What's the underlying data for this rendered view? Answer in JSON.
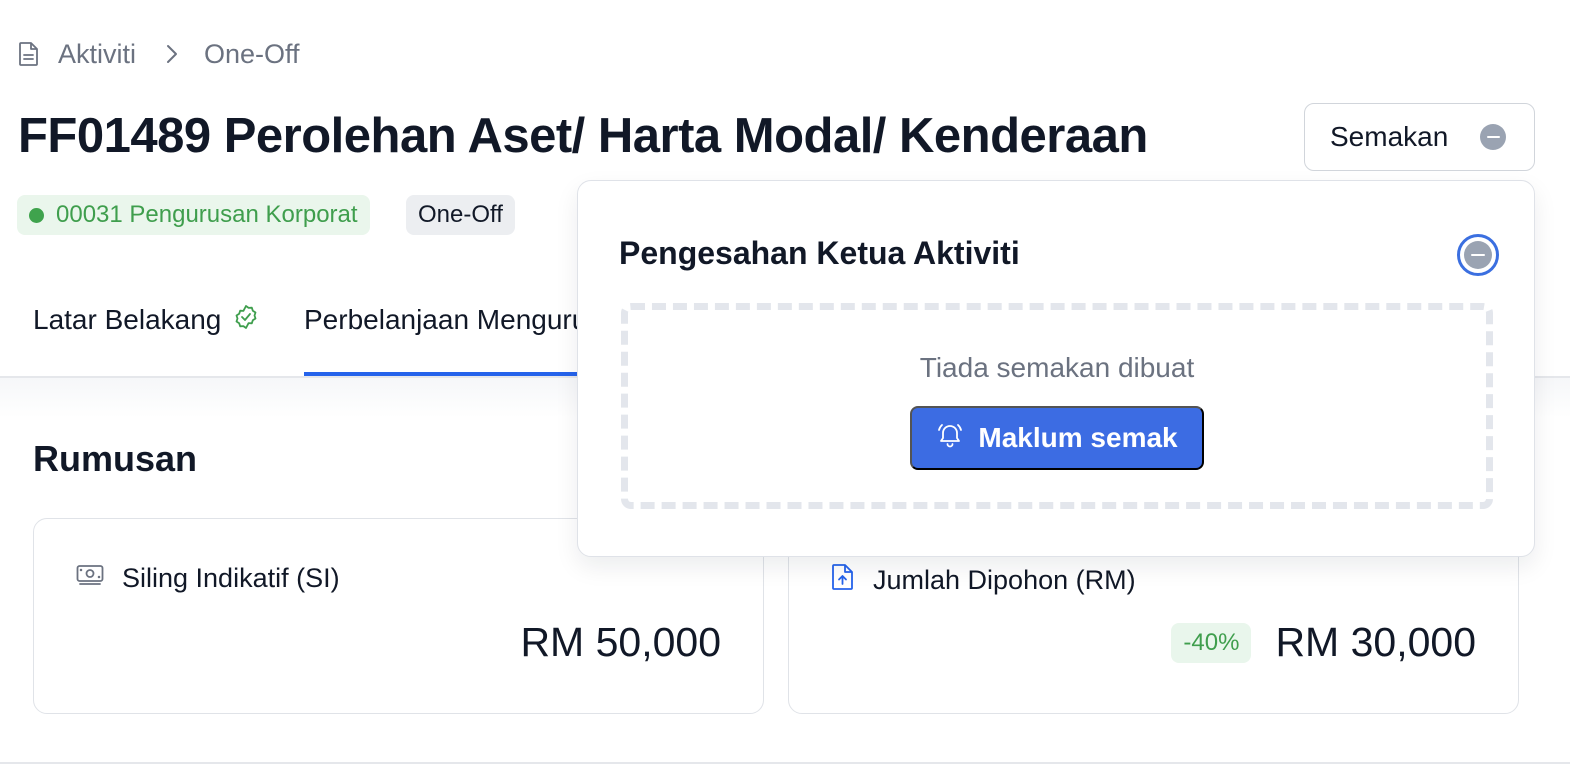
{
  "breadcrumb": {
    "icon": "document-icon",
    "root": "Aktiviti",
    "current": "One-Off"
  },
  "title": "FF01489 Perolehan Aset/ Harta Modal/ Kenderaan",
  "review_button": {
    "label": "Semakan",
    "status_icon": "minus-circle-icon"
  },
  "badges": {
    "department": "00031 Pengurusan Korporat",
    "type": "One-Off"
  },
  "tabs": [
    {
      "label": "Latar Belakang",
      "status_icon": "check-badge-icon"
    },
    {
      "label": "Perbelanjaan Mengurus",
      "active": true
    }
  ],
  "section": {
    "title": "Rumusan"
  },
  "cards": [
    {
      "icon": "money-icon",
      "label": "Siling Indikatif (SI)",
      "value": "RM 50,000"
    },
    {
      "icon": "file-upload-icon",
      "label": "Jumlah Dipohon (RM)",
      "percent": "-40%",
      "value": "RM 30,000"
    }
  ],
  "popover": {
    "title": "Pengesahan Ketua Aktiviti",
    "empty_text": "Tiada semakan dibuat",
    "button_label": "Maklum semak"
  },
  "colors": {
    "accent": "#3c6ce3",
    "success": "#3f9e4d",
    "tab_active": "#2563eb"
  }
}
